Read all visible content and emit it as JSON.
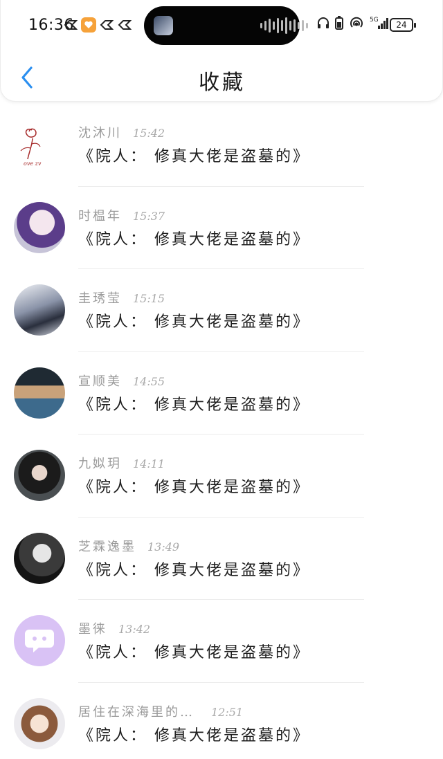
{
  "status_bar": {
    "time": "16:36",
    "battery": "24",
    "network": "5G"
  },
  "nav": {
    "title": "收藏",
    "accent_color": "#2b8ff0"
  },
  "items": [
    {
      "name": "沈沐川",
      "time": "15:42",
      "message": "《院人： 修真大佬是盗墓的》",
      "avatar": "rose-sketch"
    },
    {
      "name": "时榅年",
      "time": "15:37",
      "message": "《院人： 修真大佬是盗墓的》",
      "avatar": "anime-girl-purple-hair"
    },
    {
      "name": "圭琇莹",
      "time": "15:15",
      "message": "《院人： 修真大佬是盗墓的》",
      "avatar": "anime-couple"
    },
    {
      "name": "宣顺美",
      "time": "14:55",
      "message": "《院人： 修真大佬是盗墓的》",
      "avatar": "anime-man-cap"
    },
    {
      "name": "九姒玥",
      "time": "14:11",
      "message": "《院人： 修真大佬是盗墓的》",
      "avatar": "dark-haired-woman"
    },
    {
      "name": "芝霖逸墨",
      "time": "13:49",
      "message": "《院人： 修真大佬是盗墓的》",
      "avatar": "white-haired-character"
    },
    {
      "name": "墨徕",
      "time": "13:42",
      "message": "《院人： 修真大佬是盗墓的》",
      "avatar": "default-chat-bubble"
    },
    {
      "name": "居住在深海里的…",
      "time": "12:51",
      "message": "《院人： 修真大佬是盗墓的》",
      "avatar": "cartoon-girl-brown-hair"
    }
  ]
}
